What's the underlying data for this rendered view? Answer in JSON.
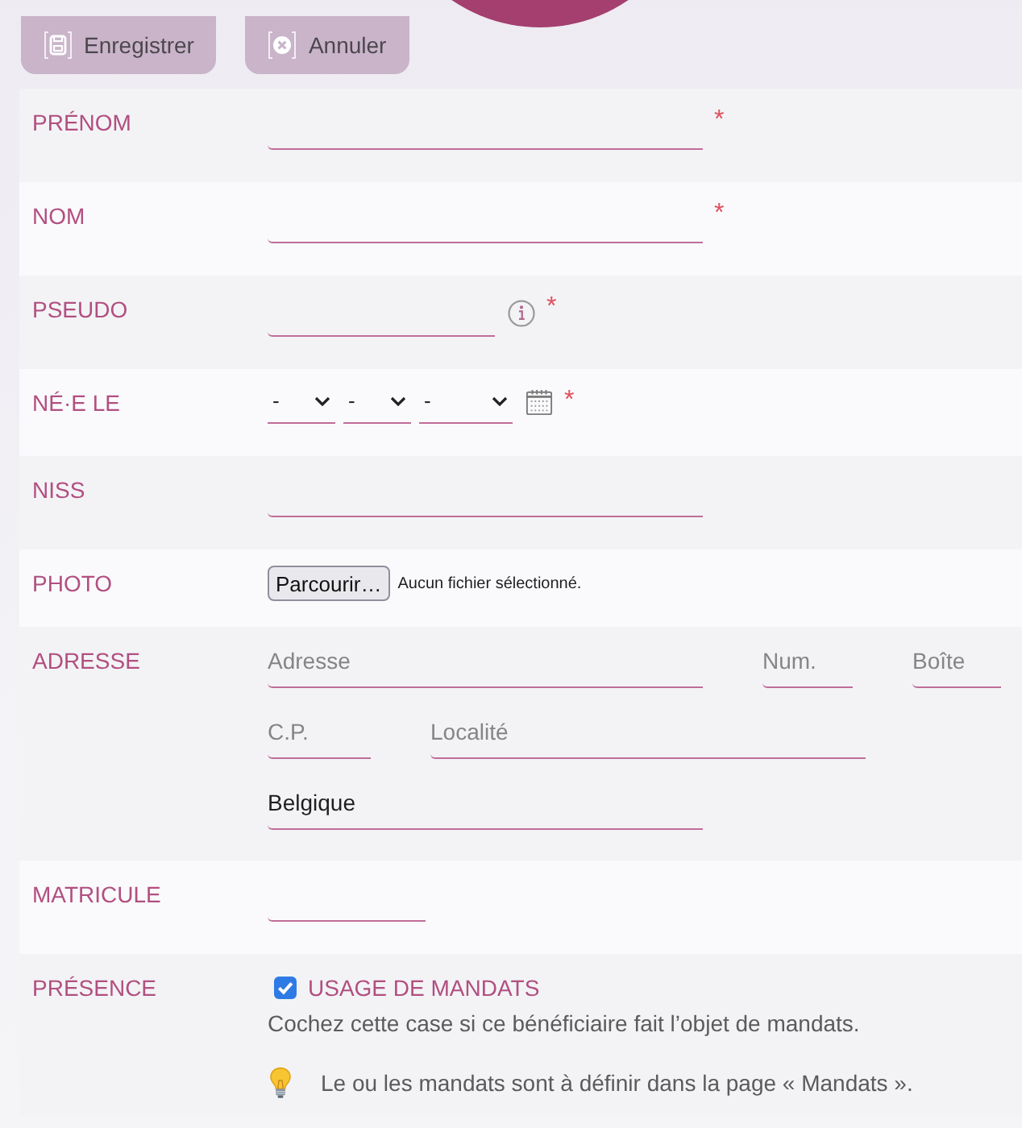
{
  "toolbar": {
    "buttons": [
      {
        "label": "Enregistrer",
        "kind": "save"
      },
      {
        "label": "Annuler",
        "kind": "cancel"
      }
    ]
  },
  "form": {
    "rows": [
      {
        "label": "PRÉNOM",
        "kind": "text",
        "required_mark": "*"
      },
      {
        "label": "NOM",
        "kind": "text",
        "required_mark": "*"
      },
      {
        "label": "PSEUDO",
        "kind": "text_info",
        "required_mark": "*"
      },
      {
        "label": "NÉ·E LE",
        "kind": "date",
        "selects": [
          {
            "kind": "day",
            "value": "-"
          },
          {
            "kind": "month",
            "value": "-"
          },
          {
            "kind": "year",
            "value": "-"
          }
        ],
        "required_mark": "*"
      },
      {
        "label": "NISS",
        "kind": "text"
      },
      {
        "label": "PHOTO",
        "kind": "file",
        "button": "Parcourir…",
        "status": "Aucun fichier sélectionné."
      },
      {
        "label": "ADRESSE",
        "kind": "address",
        "lines": [
          {
            "fields": [
              {
                "kind": "street",
                "placeholder": "Adresse"
              },
              {
                "kind": "number",
                "placeholder": "Num."
              },
              {
                "kind": "box",
                "placeholder": "Boîte"
              }
            ]
          },
          {
            "fields": [
              {
                "kind": "postcode",
                "placeholder": "C.P."
              },
              {
                "kind": "city",
                "placeholder": "Localité"
              }
            ]
          },
          {
            "fields": [
              {
                "kind": "country",
                "value": "Belgique"
              }
            ]
          }
        ]
      },
      {
        "label": "MATRICULE",
        "kind": "code"
      },
      {
        "label": "PRÉSENCE",
        "kind": "checkbox",
        "option": {
          "label": "USAGE DE MANDATS",
          "checked": true
        },
        "help": "Cochez cette case si ce bénéficiaire fait l’objet de mandats.",
        "tip": "Le ou les mandats sont à définir dans la page « Mandats »."
      }
    ]
  }
}
